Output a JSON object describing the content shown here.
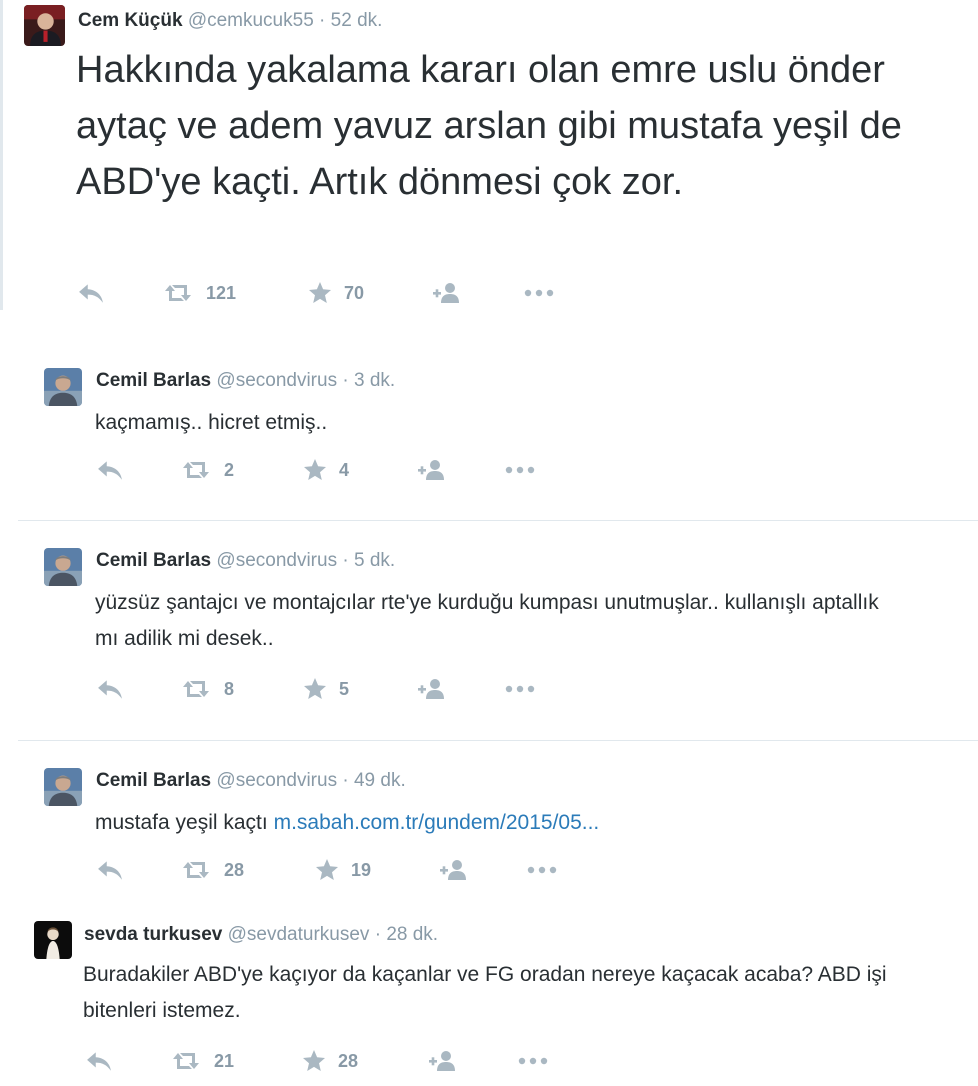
{
  "colors": {
    "name": "#292f33",
    "meta": "#8899a6",
    "action_icon": "#aab8c2",
    "link": "#2b7bb9",
    "divider": "#e1e8ed"
  },
  "icons": {
    "reply": "reply-icon",
    "retweet": "retweet-icon",
    "favorite": "star-icon",
    "follow": "follow-icon",
    "more": "more-icon"
  },
  "main_tweet": {
    "name": "Cem Küçük",
    "handle": "@cemkucuk55",
    "separator": "·",
    "time": "52 dk.",
    "text": "Hakkında yakalama kararı olan emre uslu önder aytaç ve adem yavuz arslan gibi mustafa yeşil de ABD'ye kaçti. Artık dönmesi çok zor.",
    "retweets": "121",
    "favorites": "70"
  },
  "replies": [
    {
      "name": "Cemil Barlas",
      "handle": "@secondvirus",
      "separator": "·",
      "time": "3 dk.",
      "text": "kaçmamış.. hicret etmiş..",
      "retweets": "2",
      "favorites": "4"
    },
    {
      "name": "Cemil Barlas",
      "handle": "@secondvirus",
      "separator": "·",
      "time": "5 dk.",
      "text": "yüzsüz şantajcı ve montajcılar rte'ye kurduğu kumpası unutmuşlar.. kullanışlı aptallık mı adilik mi desek..",
      "retweets": "8",
      "favorites": "5"
    },
    {
      "name": "Cemil Barlas",
      "handle": "@secondvirus",
      "separator": "·",
      "time": "49 dk.",
      "text": "mustafa yeşil kaçtı",
      "link": "m.sabah.com.tr/gundem/2015/05...",
      "retweets": "28",
      "favorites": "19"
    },
    {
      "name": "sevda turkusev",
      "handle": "@sevdaturkusev",
      "separator": "·",
      "time": "28 dk.",
      "text": "Buradakiler ABD'ye kaçıyor da kaçanlar ve FG oradan nereye kaçacak acaba? ABD işi bitenleri istemez.",
      "retweets": "21",
      "favorites": "28"
    }
  ]
}
